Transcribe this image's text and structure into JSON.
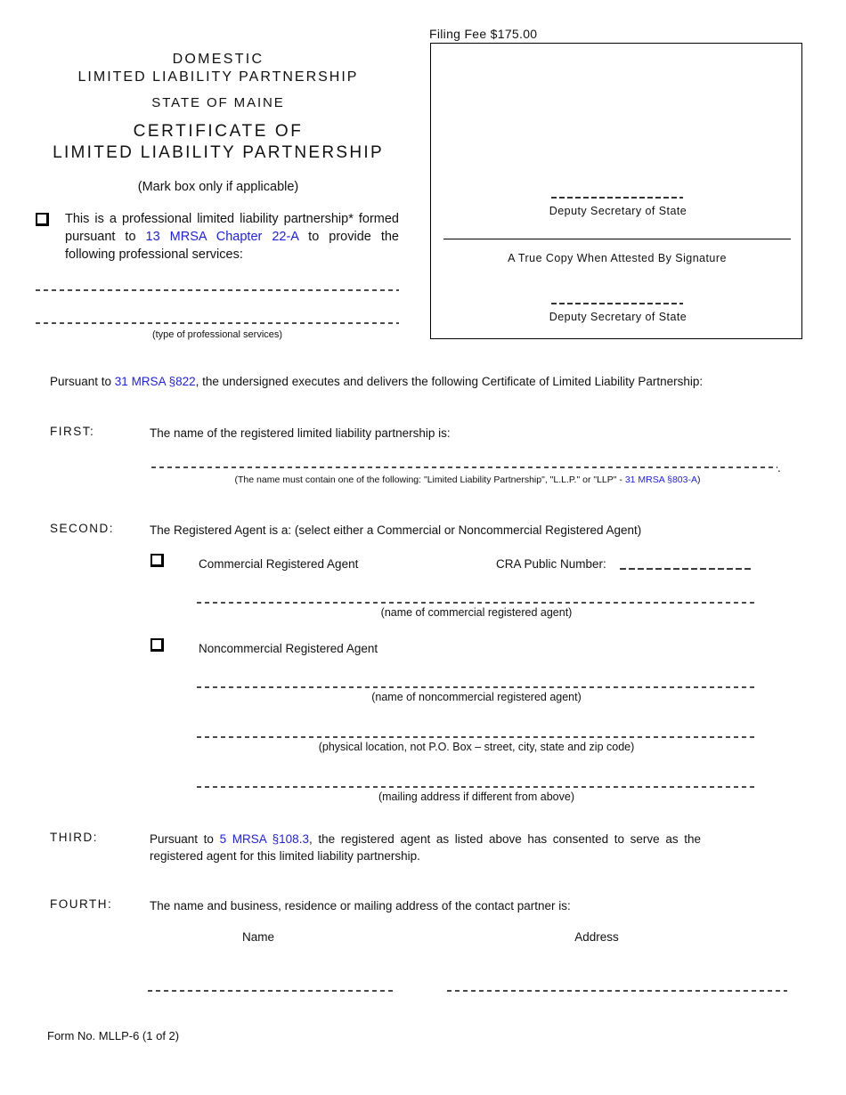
{
  "document": {
    "header": {
      "domestic": "DOMESTIC",
      "llp": "LIMITED LIABILITY PARTNERSHIP",
      "state": "STATE OF MAINE",
      "certificate_of": "CERTIFICATE OF",
      "certificate_llp": "LIMITED LIABILITY PARTNERSHIP",
      "mark_box_note": "(Mark box only if applicable)"
    },
    "professional": {
      "text_before_link": "This is a professional limited liability partnership* formed pursuant to ",
      "link": "13 MRSA Chapter 22-A",
      "text_after_link": " to provide the following professional services:",
      "services_caption": "(type of professional services)"
    },
    "filing": {
      "fee_label": "Filing Fee $175.00",
      "deputy_line_1": "Deputy Secretary of State",
      "attest_text": "A True Copy When Attested By Signature",
      "deputy_line_2": "Deputy Secretary of State"
    },
    "intro": {
      "before_link": "Pursuant to ",
      "link": "31 MRSA §822",
      "after_link": ", the undersigned executes and delivers the following Certificate of Limited Liability Partnership:"
    },
    "sections": {
      "first": {
        "label": "FIRST:",
        "text": "The name of the registered limited liability partnership is:",
        "name_note_before": "(The name must contain one of the following:  \"Limited Liability Partnership\", \"L.L.P.\" or \"LLP\" - ",
        "name_note_link": "31 MRSA §803-A",
        "name_note_after": ")"
      },
      "second": {
        "label": "SECOND:",
        "text": "The Registered Agent is a:  (select either a Commercial or Noncommercial Registered Agent)",
        "commercial_label": "Commercial Registered Agent",
        "cra_public_number_label": "CRA Public Number:",
        "commercial_caption": "(name of commercial registered agent)",
        "noncommercial_label": "Noncommercial Registered Agent",
        "noncommercial_caption": "(name of  noncommercial registered agent)",
        "physical_caption": "(physical location, not P.O. Box – street, city, state and zip code)",
        "mailing_caption": "(mailing address if different from above)"
      },
      "third": {
        "label": "THIRD:",
        "before_link": "Pursuant to ",
        "link": "5 MRSA §108.3",
        "after_link": ", the registered agent as listed above has consented to serve as the registered agent for this limited liability partnership."
      },
      "fourth": {
        "label": "FOURTH:",
        "text": "The name and business, residence or mailing address of the contact partner is:",
        "col_name": "Name",
        "col_address": "Address"
      }
    },
    "footer": {
      "form_number": "Form No. MLLP-6 (1 of 2)"
    },
    "colors": {
      "link": "#1f1fe0",
      "text": "#111111",
      "rule": "#4a4a4a"
    }
  }
}
